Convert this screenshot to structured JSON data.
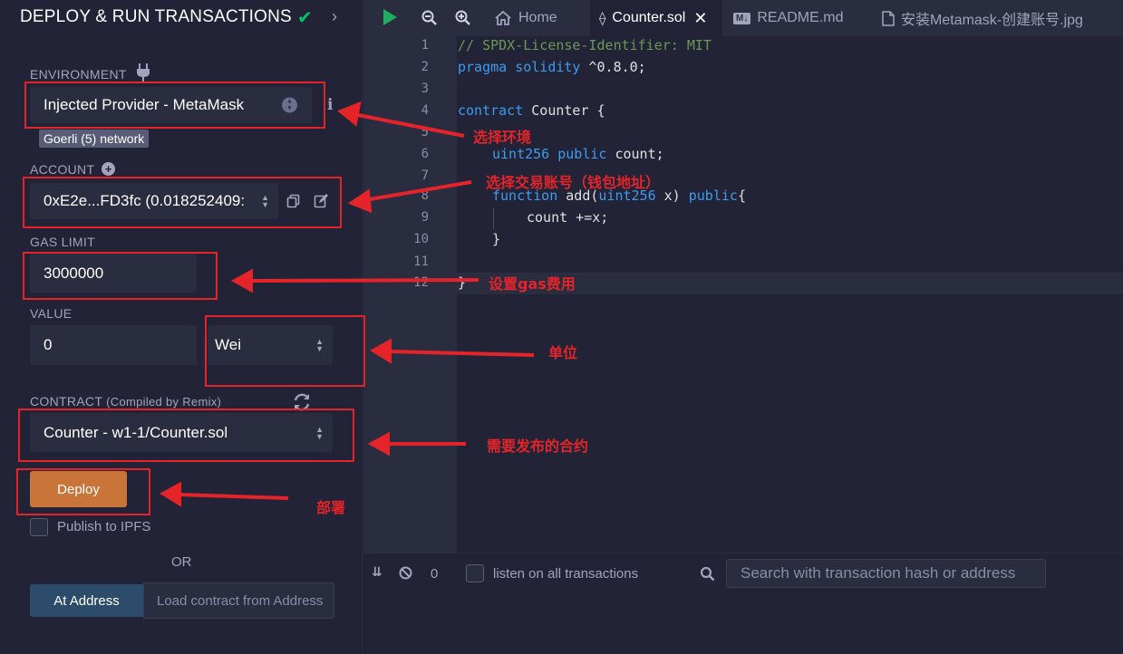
{
  "left_panel": {
    "title": "DEPLOY & RUN TRANSACTIONS",
    "environment_label": "ENVIRONMENT",
    "environment_value": "Injected Provider - MetaMask",
    "network_badge": "Goerli (5) network",
    "account_label": "ACCOUNT",
    "account_value": "0xE2e...FD3fc (0.018252409:",
    "gas_limit_label": "GAS LIMIT",
    "gas_limit_value": "3000000",
    "value_label": "VALUE",
    "value_amount": "0",
    "value_unit": "Wei",
    "contract_label": "CONTRACT",
    "contract_sublabel": "(Compiled by Remix)",
    "contract_value": "Counter - w1-1/Counter.sol",
    "deploy_label": "Deploy",
    "publish_ipfs_label": "Publish to IPFS",
    "or_label": "OR",
    "at_address_label": "At Address",
    "load_address_placeholder": "Load contract from Address"
  },
  "tabs": [
    {
      "label": "Home"
    },
    {
      "label": "Counter.sol"
    },
    {
      "label": "README.md"
    },
    {
      "label": "安装Metamask-创建账号.jpg"
    }
  ],
  "editor": {
    "line_numbers": [
      "1",
      "2",
      "3",
      "4",
      "5",
      "6",
      "7",
      "8",
      "9",
      "10",
      "11",
      "12"
    ],
    "code": {
      "l1": "// SPDX-License-Identifier: MIT",
      "l2_kw": "pragma solidity",
      "l2_rest": " ^0.8.0;",
      "l4_kw": "contract",
      "l4_rest": " Counter {",
      "l6_type": "uint256",
      "l6_kw": " public",
      "l6_rest": " count;",
      "l8_kw": "function",
      "l8_mid": " add(",
      "l8_type": "uint256",
      "l8_mid2": " x) ",
      "l8_kw2": "public",
      "l8_end": "{",
      "l9": "count +=x;",
      "l10": "}",
      "l12": "}"
    }
  },
  "terminal": {
    "count": "0",
    "listen_label": "listen on all transactions",
    "search_placeholder": "Search with transaction hash or address"
  },
  "annotations": {
    "env": "选择环境",
    "account": "选择交易账号（钱包地址）",
    "gas": "设置gas费用",
    "unit": "单位",
    "contract": "需要发布的合约",
    "deploy": "部署"
  },
  "colors": {
    "background": "#222336",
    "panel": "#2a2c3f",
    "deploy_button": "#c97539",
    "annotation_red": "#e5242a",
    "check_green": "#00c46b",
    "keyword_blue": "#3c9cf0"
  }
}
